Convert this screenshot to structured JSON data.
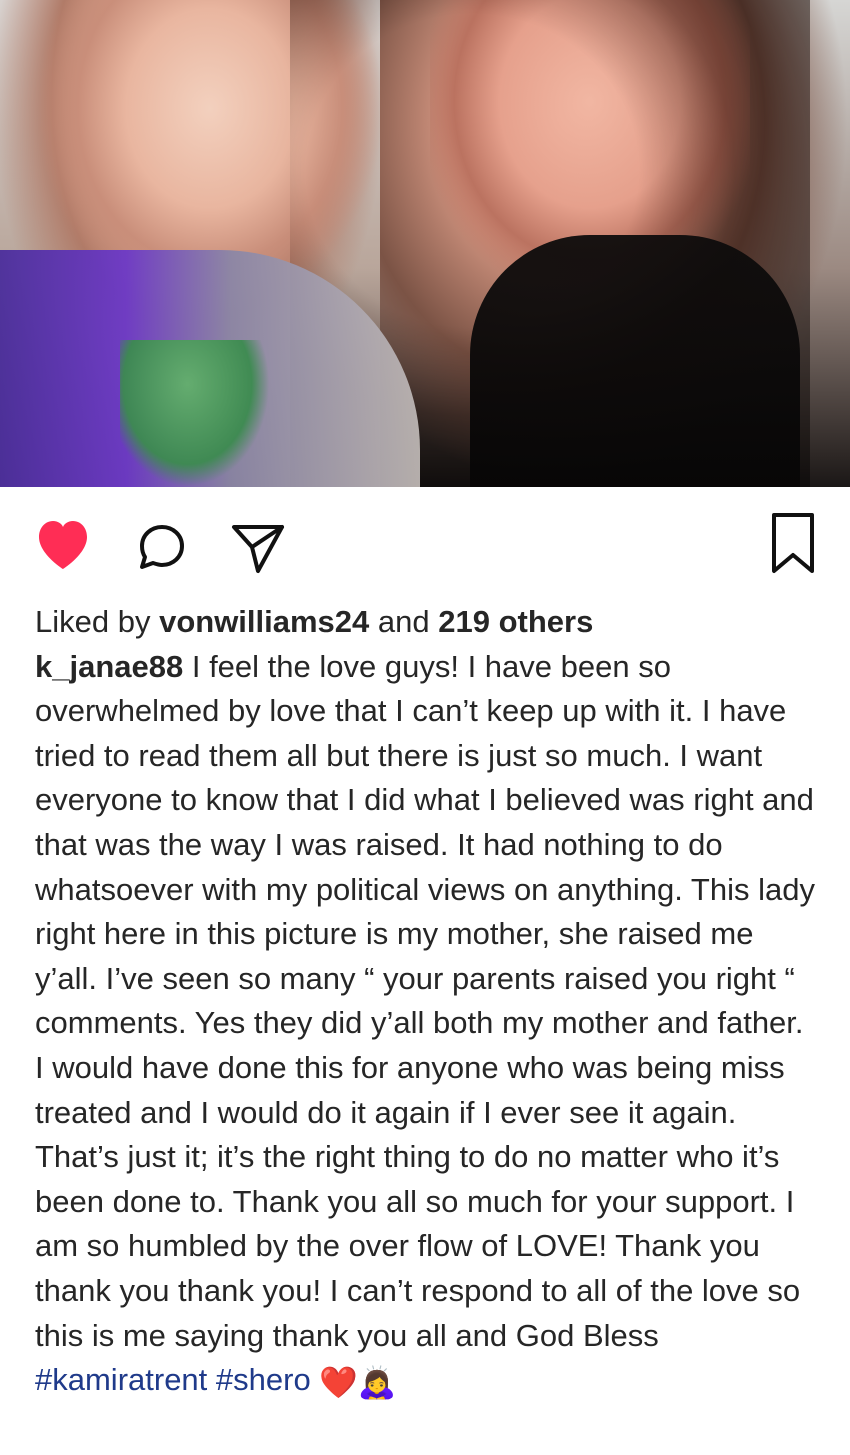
{
  "photo": {
    "alt": ""
  },
  "actions": {
    "like_icon": "heart-icon",
    "comment_icon": "comment-icon",
    "share_icon": "share-icon",
    "save_icon": "bookmark-icon",
    "like_color": "#ff2d55"
  },
  "likes": {
    "prefix": "Liked by ",
    "user": "vonwilliams24",
    "middle": " and ",
    "count": "219 others"
  },
  "caption": {
    "username": "k_janae88",
    "text": " I feel the love guys! I have been so overwhelmed by love that I can’t keep up with it. I have tried to read them all but there is just so much. I want everyone to know that I did what I believed was right and that was the way I was raised. It had nothing to do whatsoever with my political views on anything. This lady right here in this picture is my mother, she raised me y’all. I’ve seen so many “ your parents raised you right “ comments. Yes they did y’all both my mother and father. I would have done this for anyone who was being miss treated and I would do it again if I ever see it again. That’s just it; it’s the right thing to do no matter who it’s been done to. Thank you all so much for your support. I am so humbled by the over flow of LOVE! Thank you thank you thank you!  I can’t respond to all of the love so this is me saying thank you all and God Bless",
    "hashtags": "#kamiratrent #shero",
    "emoji_1": "❤️",
    "emoji_2": "🙇‍♀️"
  }
}
